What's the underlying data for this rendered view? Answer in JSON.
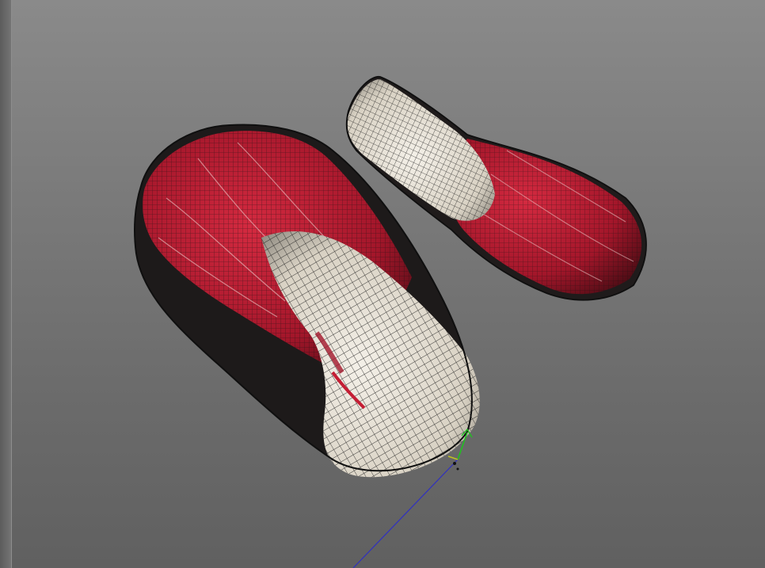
{
  "viewport": {
    "kind": "3d-viewport",
    "background_top": "#8a8a8a",
    "background_bottom": "#606060"
  },
  "objects": [
    {
      "name": "cabbage-large-mesh",
      "shading": "wireframe-on-shaded",
      "leaf_color": "#b0182c",
      "core_color": "#e8e2d6"
    },
    {
      "name": "cabbage-half-mesh",
      "shading": "wireframe-on-shaded",
      "leaf_color": "#b0182c",
      "core_color": "#e8e2d6"
    }
  ],
  "gizmo": {
    "axis_colors": {
      "x": "#c0c020",
      "y": "#20c020",
      "z": "#3030c0"
    }
  }
}
